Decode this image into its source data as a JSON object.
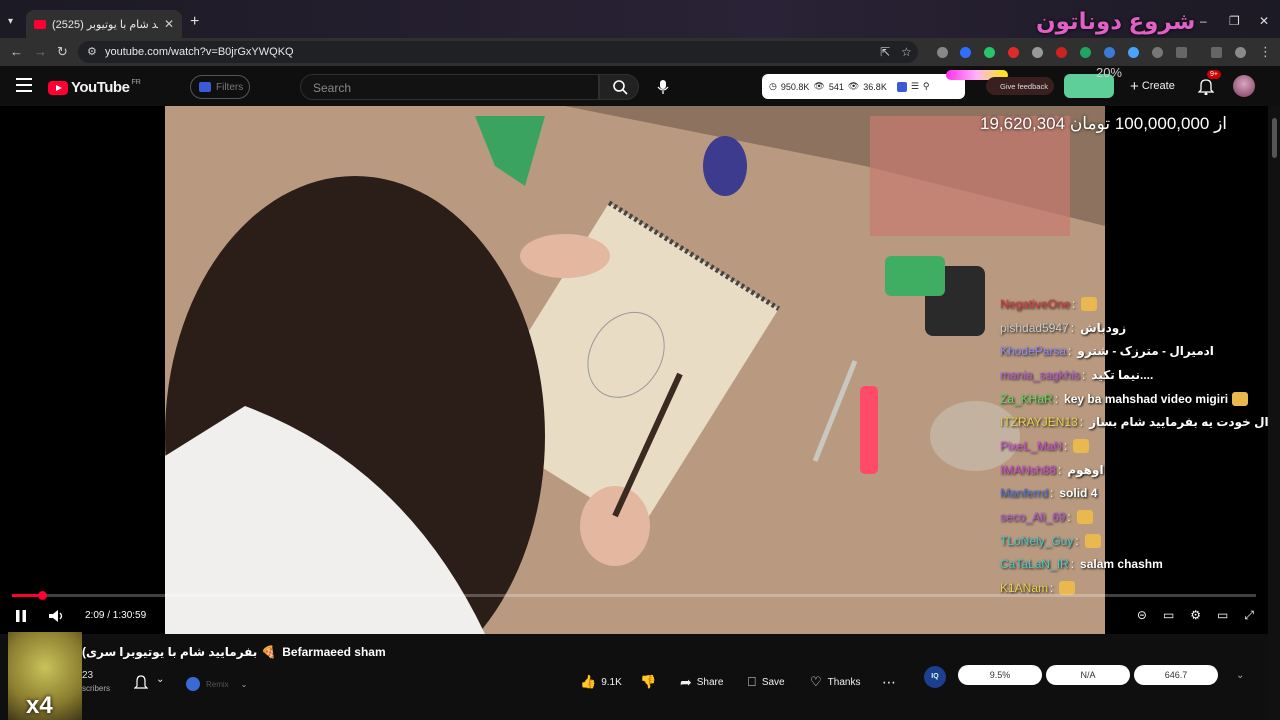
{
  "browser": {
    "tab_title": "(2525) بفرمایید شام با یوتیوبر",
    "new_tab": "+",
    "tab_close": "✕",
    "url": "youtube.com/watch?v=B0jrGxYWQKQ",
    "overlay_title": "شروع دوناتون",
    "window_minimize": "–",
    "window_restore": "❐",
    "window_close": "✕"
  },
  "header": {
    "logo_text": "YouTube",
    "logo_country": "FR",
    "filters_label": "Filters",
    "search_placeholder": "Search",
    "stats": {
      "views": "950.8K",
      "watching": "541",
      "likes_viewers": "36.8K"
    },
    "feedback_label": "Give feedback",
    "donation_pct": "20%",
    "create_label": "Create",
    "notification_badge": "9+"
  },
  "player": {
    "goal_overlay": "19,620,304 از 100,000,000 تومان",
    "current_time": "2:09",
    "duration": "1:30:59",
    "time_text": "2:09 / 1:30:59",
    "progress_fraction": 0.024
  },
  "chat": [
    {
      "user": "NegativeOne",
      "color": "#d63a3a",
      "message": "",
      "emote": true
    },
    {
      "user": "pishdad5947",
      "color": "#cccccc",
      "message": "زودباش",
      "emote": false
    },
    {
      "user": "KhodeParsa",
      "color": "#8a8aff",
      "message": "ادمیرال - مترزک - شترو",
      "emote": false
    },
    {
      "user": "mania_sagkhis",
      "color": "#b45ad6",
      "message": "نیما تکید....",
      "emote": false
    },
    {
      "user": "Za_KHaR",
      "color": "#5ddb5d",
      "message": "key ba mahshad video migiri",
      "emote": true
    },
    {
      "user": "ITZRAYJEN13",
      "color": "#e8d14a",
      "message": "ادمیرال خودت یه بفرمایید شام بساز",
      "emote": false
    },
    {
      "user": "PixeL_MaN",
      "color": "#d44fd4",
      "message": "",
      "emote": true
    },
    {
      "user": "IMANsh88",
      "color": "#d44fd4",
      "message": "اوهوم",
      "emote": false
    },
    {
      "user": "Manferrd",
      "color": "#4b73d6",
      "message": "solid 4",
      "emote": false
    },
    {
      "user": "seco_Ali_69",
      "color": "#b45ad6",
      "message": "",
      "emote": true
    },
    {
      "user": "TLoNely_Guy",
      "color": "#4bc8c8",
      "message": "",
      "emote": true
    },
    {
      "user": "CaTaLaN_IR",
      "color": "#4bc8c8",
      "message": "salam chashm",
      "emote": false
    },
    {
      "user": "K1ANam",
      "color": "#e8d14a",
      "message": "",
      "emote": true
    }
  ],
  "video": {
    "title": "(سری ۷) بفرمایید شام با یوتیوبرا 🍕 Befarmaeed sham",
    "title_prefix": "(سری",
    "title_main": "بفرمایید شام با یوتیوبرا",
    "title_emoji": "🍕",
    "title_latin": "Befarmaeed sham",
    "subscriber_count": "23",
    "subscriber_label": "scribers",
    "thumb_overlay": "x4",
    "join_label": "Remix",
    "likes": "9.1K",
    "share_label": "Share",
    "save_label": "Save",
    "thanks_label": "Thanks",
    "iq_label": "IQ",
    "stat_pills": [
      "9.5%",
      "N/A",
      "646.7"
    ]
  },
  "colors": {
    "accent": "#ff0033",
    "bg": "#0f0f0f"
  }
}
